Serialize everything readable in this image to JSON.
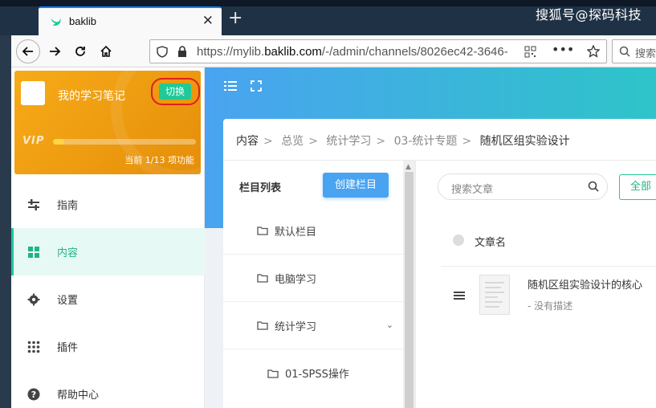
{
  "browser": {
    "tab_title": "baklib",
    "url_prefix": "https://mylib.",
    "url_domain": "baklib.com",
    "url_rest": "/-/admin/channels/8026ec42-3646-",
    "search_placeholder": "搜索"
  },
  "watermark": "搜狐号@探码科技",
  "kb": {
    "name": "我的学习笔记",
    "switch_label": "切换",
    "vip_label": "VIP",
    "quota_text": "当前 1/13 项功能",
    "quota_fraction": 0.077
  },
  "sidebar": {
    "items": [
      {
        "label": "指南",
        "icon": "sliders-icon"
      },
      {
        "label": "内容",
        "icon": "grid-icon",
        "active": true
      },
      {
        "label": "设置",
        "icon": "gear-icon"
      },
      {
        "label": "插件",
        "icon": "apps-icon"
      },
      {
        "label": "帮助中心",
        "icon": "help-icon"
      }
    ]
  },
  "breadcrumb": [
    "内容",
    "总览",
    "统计学习",
    "03-统计专题",
    "随机区组实验设计"
  ],
  "columns": {
    "title": "栏目列表",
    "create_button": "创建栏目",
    "items": [
      "默认栏目",
      "电脑学习",
      "统计学习"
    ],
    "sub_items": [
      "01-SPSS操作"
    ]
  },
  "articles": {
    "search_placeholder": "搜索文章",
    "filter_all": "全部",
    "header_label": "文章名",
    "rows": [
      {
        "title": "随机区组实验设计的核心",
        "desc": "- 没有描述"
      }
    ]
  },
  "colors": {
    "accent": "#20c997",
    "primary": "#4aa3f0",
    "kb_card": "#f7ab18"
  }
}
